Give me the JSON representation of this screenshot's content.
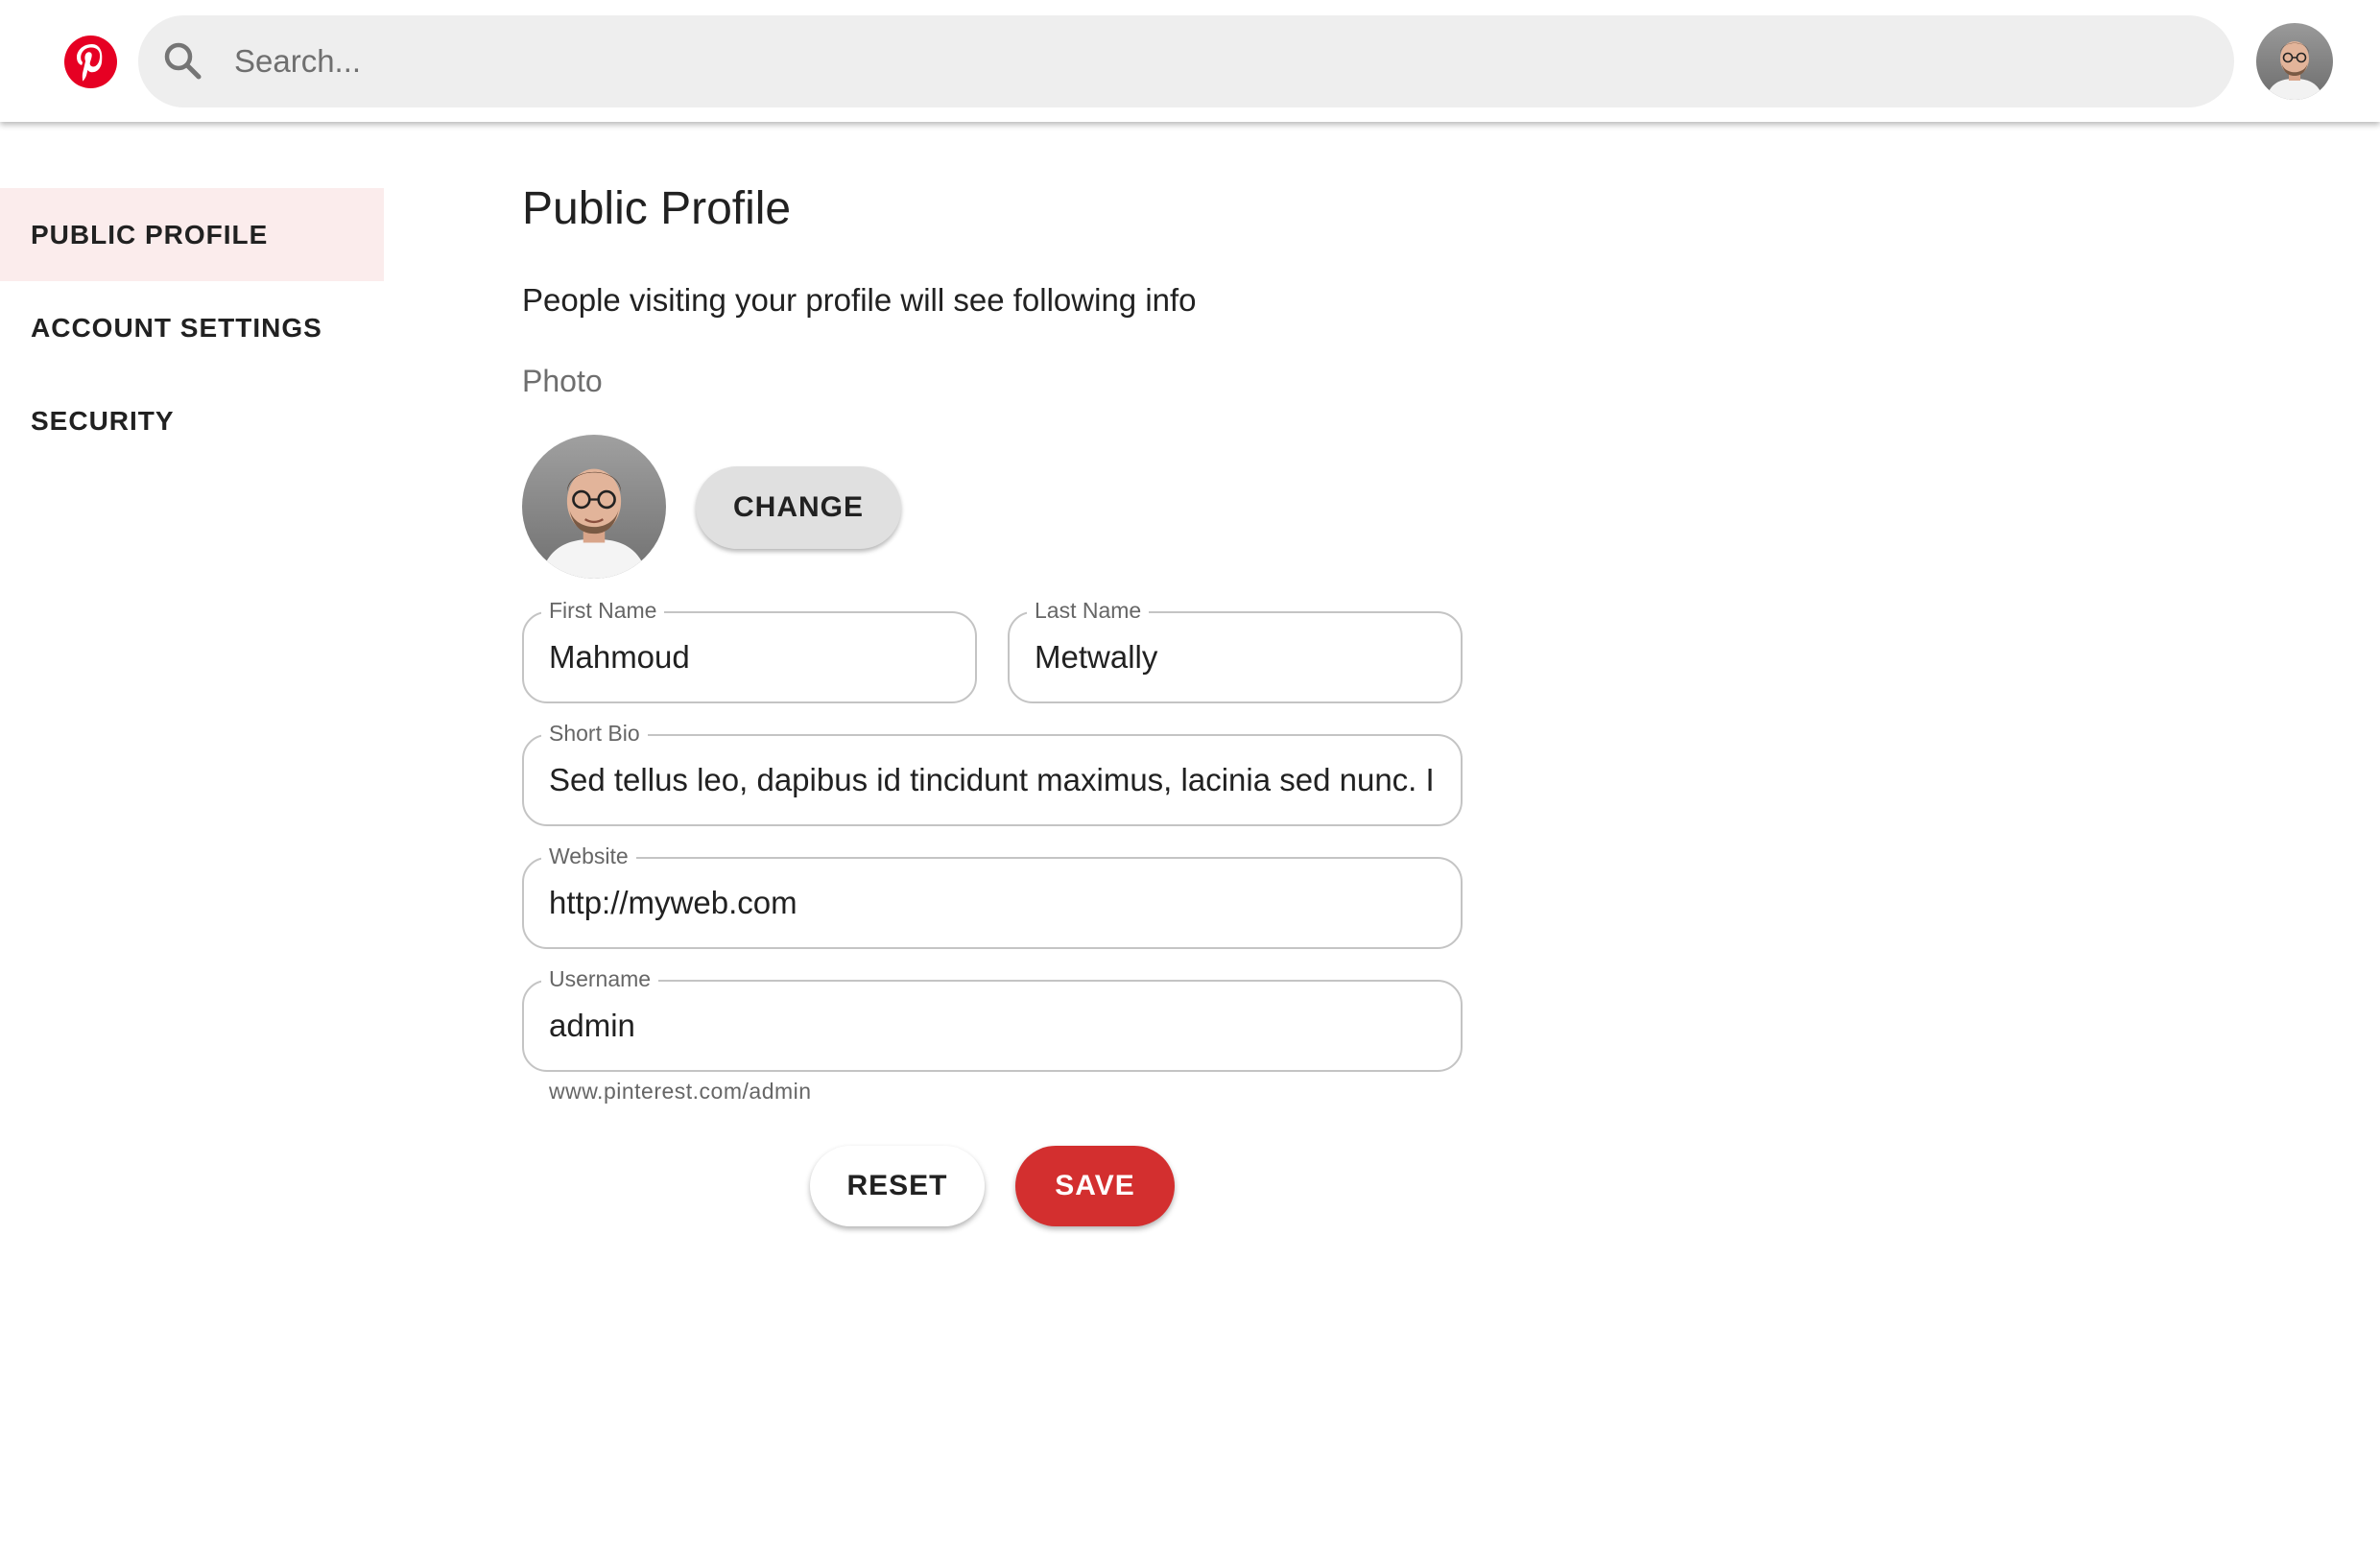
{
  "header": {
    "logo_icon": "pinterest-logo",
    "brand_color": "#E60023",
    "search": {
      "icon": "search-icon",
      "placeholder": "Search...",
      "value": ""
    },
    "avatar_icon": "user-avatar"
  },
  "sidebar": {
    "items": [
      {
        "label": "PUBLIC PROFILE",
        "active": true
      },
      {
        "label": "ACCOUNT SETTINGS",
        "active": false
      },
      {
        "label": "SECURITY",
        "active": false
      }
    ],
    "active_background": "#FBECEC"
  },
  "profile": {
    "title": "Public Profile",
    "description": "People visiting your profile will see following info",
    "photo_label": "Photo",
    "change_button": "CHANGE",
    "fields": {
      "first_name": {
        "label": "First Name",
        "value": "Mahmoud"
      },
      "last_name": {
        "label": "Last Name",
        "value": "Metwally"
      },
      "short_bio": {
        "label": "Short Bio",
        "value": "Sed tellus leo, dapibus id tincidunt maximus, lacinia sed nunc. In"
      },
      "website": {
        "label": "Website",
        "value": "http://myweb.com"
      },
      "username": {
        "label": "Username",
        "value": "admin",
        "helper": "www.pinterest.com/admin"
      }
    },
    "reset_button": "RESET",
    "save_button": "SAVE",
    "save_color": "#D32F2F"
  }
}
